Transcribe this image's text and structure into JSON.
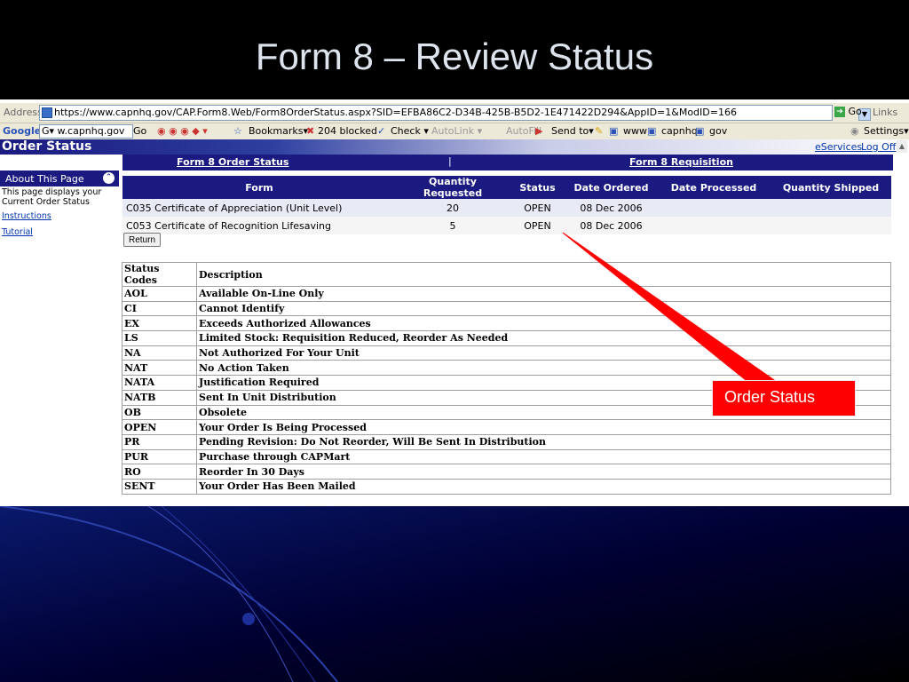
{
  "slide": {
    "title": "Form 8 – Review Status",
    "callout_label": "Order Status",
    "callout_color": "#ff0000"
  },
  "browser": {
    "address_label": "Address",
    "url": "https://www.capnhq.gov/CAP.Form8.Web/Form8OrderStatus.aspx?SID=EFBA86C2-D34B-425B-B5D2-1E471422D294&AppID=1&ModID=166",
    "go_label": "Go",
    "links_label": "Links",
    "google_label": "Google",
    "google_search_value": "G▾ w.capnhq.gov",
    "toolbar": {
      "go": "Go",
      "bookmarks": "Bookmarks▾",
      "blocked": "204 blocked",
      "check": "Check ▾",
      "autolink": "AutoLink ▾",
      "autofill": "AutoFill",
      "send_to": "Send to▾",
      "www": "www",
      "capnhq": "capnhq",
      "gov": "gov",
      "settings": "Settings▾"
    }
  },
  "app": {
    "page_title": "Order Status",
    "eservices": "eServices",
    "log_off": "Log Off",
    "brand_color": "#1a1a80",
    "sidebar": {
      "about_title": "About This Page",
      "about_text": "This page displays your Current Order Status",
      "instructions": "Instructions",
      "tutorial": "Tutorial"
    },
    "tabs": [
      {
        "label": "Form 8 Order Status"
      },
      {
        "label": "Form 8 Requisition"
      }
    ],
    "tab_separator": "|",
    "orders": {
      "headers": [
        "Form",
        "Quantity Requested",
        "Status",
        "Date Ordered",
        "Date Processed",
        "Quantity Shipped"
      ],
      "rows": [
        {
          "form": "C035 Certificate of Appreciation (Unit Level)",
          "qty": "20",
          "status": "OPEN",
          "date_ordered": "08 Dec 2006",
          "date_processed": "",
          "qty_shipped": ""
        },
        {
          "form": "C053 Certificate of Recognition Lifesaving",
          "qty": "5",
          "status": "OPEN",
          "date_ordered": "08 Dec 2006",
          "date_processed": "",
          "qty_shipped": ""
        }
      ]
    },
    "return_button": "Return",
    "status_codes": {
      "headers": [
        "Status Codes",
        "Description"
      ],
      "rows": [
        {
          "code": "AOL",
          "desc": "Available On-Line Only"
        },
        {
          "code": "CI",
          "desc": "Cannot Identify"
        },
        {
          "code": "EX",
          "desc": "Exceeds Authorized Allowances"
        },
        {
          "code": "LS",
          "desc": "Limited Stock: Requisition Reduced, Reorder As Needed"
        },
        {
          "code": "NA",
          "desc": "Not Authorized For Your Unit"
        },
        {
          "code": "NAT",
          "desc": "No Action Taken"
        },
        {
          "code": "NATA",
          "desc": "Justification Required"
        },
        {
          "code": "NATB",
          "desc": "Sent In Unit Distribution"
        },
        {
          "code": "OB",
          "desc": "Obsolete"
        },
        {
          "code": "OPEN",
          "desc": "Your Order Is Being Processed"
        },
        {
          "code": "PR",
          "desc": "Pending Revision: Do Not Reorder, Will Be Sent In Distribution"
        },
        {
          "code": "PUR",
          "desc": "Purchase through CAPMart"
        },
        {
          "code": "RO",
          "desc": "Reorder In 30 Days"
        },
        {
          "code": "SENT",
          "desc": "Your Order Has Been Mailed"
        }
      ]
    }
  }
}
